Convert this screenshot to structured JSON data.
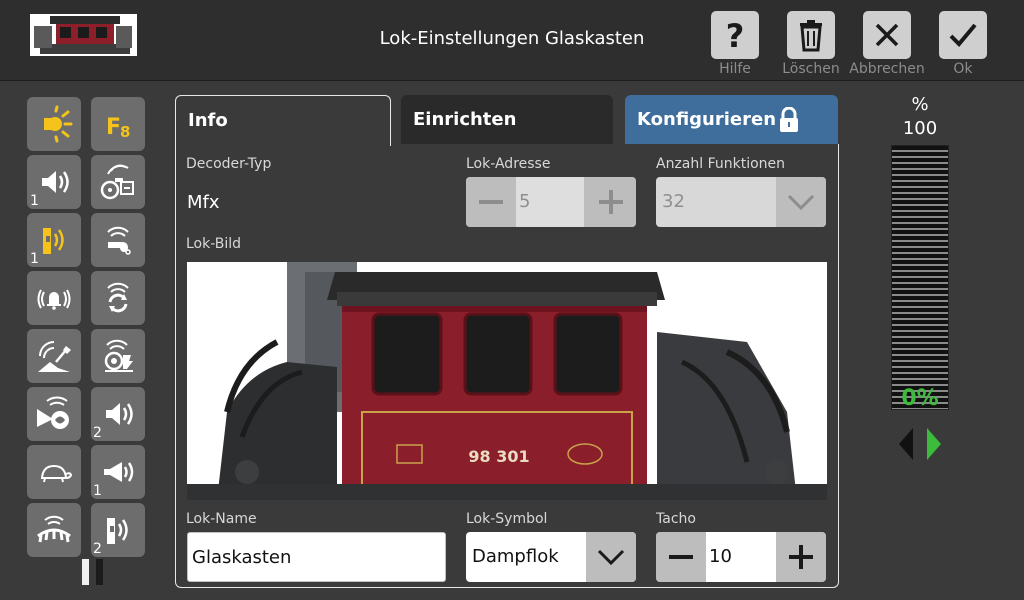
{
  "header": {
    "title": "Lok-Einstellungen Glaskasten",
    "buttons": [
      {
        "label": "Hilfe",
        "icon": "help-icon"
      },
      {
        "label": "Löschen",
        "icon": "trash-icon"
      },
      {
        "label": "Abbrechen",
        "icon": "close-icon"
      },
      {
        "label": "Ok",
        "icon": "check-icon"
      }
    ]
  },
  "sidebar": {
    "functions": [
      {
        "icon": "light-icon",
        "number": ""
      },
      {
        "icon": "function-f8-icon",
        "text": "F8",
        "number": ""
      },
      {
        "icon": "sound-icon",
        "number": "1"
      },
      {
        "icon": "steam-engine-sound-icon",
        "number": ""
      },
      {
        "icon": "whistle-icon",
        "number": "1"
      },
      {
        "icon": "horn-icon",
        "number": ""
      },
      {
        "icon": "bell-icon",
        "number": ""
      },
      {
        "icon": "brake-sound-icon",
        "number": ""
      },
      {
        "icon": "coal-shovel-icon",
        "number": ""
      },
      {
        "icon": "generator-sound-icon",
        "number": ""
      },
      {
        "icon": "air-pump-sound-icon",
        "number": ""
      },
      {
        "icon": "sound-icon",
        "number": "2"
      },
      {
        "icon": "shunting-speed-icon",
        "number": ""
      },
      {
        "icon": "announcement-icon",
        "number": "1"
      },
      {
        "icon": "rail-joint-icon",
        "number": ""
      },
      {
        "icon": "whistle-icon",
        "number": "2"
      }
    ]
  },
  "tabs": [
    {
      "label": "Info"
    },
    {
      "label": "Einrichten"
    },
    {
      "label": "Konfigurieren"
    }
  ],
  "info": {
    "decoder_type_label": "Decoder-Typ",
    "decoder_type_value": "Mfx",
    "address_label": "Lok-Adresse",
    "address_value": "5",
    "functions_count_label": "Anzahl Funktionen",
    "functions_count_value": "32",
    "image_label": "Lok-Bild",
    "name_label": "Lok-Name",
    "name_value": "Glaskasten",
    "symbol_label": "Lok-Symbol",
    "symbol_value": "Dampflok",
    "tacho_label": "Tacho",
    "tacho_value": "10",
    "loco_plate": "98 301"
  },
  "speed": {
    "unit": "%",
    "max": "100",
    "current": "0%",
    "level": 0
  },
  "colors": {
    "accent_tab": "#3f6e9c",
    "function_active": "#f5c31a",
    "speed_green": "#3dbb3d"
  }
}
